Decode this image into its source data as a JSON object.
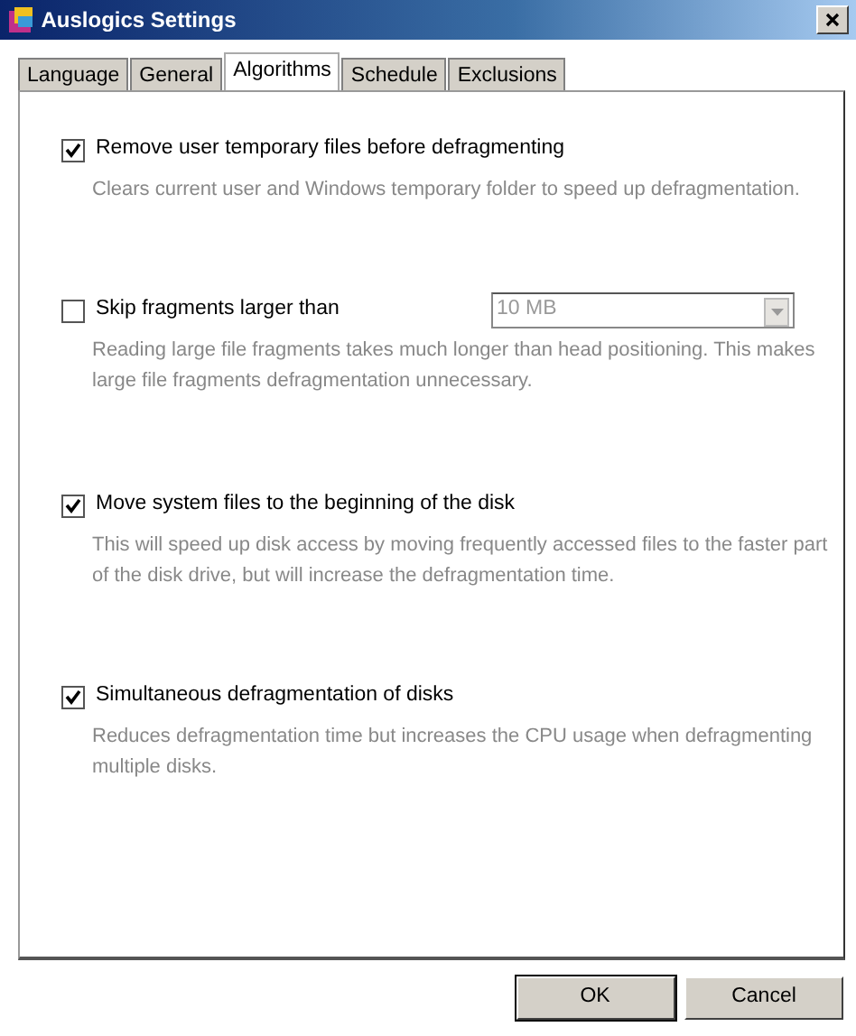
{
  "window": {
    "title": "Auslogics Settings"
  },
  "tabs": [
    {
      "label": "Language",
      "selected": false
    },
    {
      "label": "General",
      "selected": false
    },
    {
      "label": "Algorithms",
      "selected": true
    },
    {
      "label": "Schedule",
      "selected": false
    },
    {
      "label": "Exclusions",
      "selected": false
    }
  ],
  "options": [
    {
      "label": "Remove user temporary files before defragmenting",
      "checked": true,
      "description": "Clears current user and Windows temporary folder to speed up defragmentation."
    },
    {
      "label": "Skip fragments larger than",
      "checked": false,
      "description": "Reading large file fragments takes much longer than head positioning. This makes large file fragments defragmentation unnecessary.",
      "dropdown": {
        "value": "10 MB",
        "disabled": true
      }
    },
    {
      "label": "Move system files to the beginning of the disk",
      "checked": true,
      "description": "This will speed up disk access by moving frequently accessed files to the faster part of the disk drive, but will increase the defragmentation time."
    },
    {
      "label": "Simultaneous defragmentation of disks",
      "checked": true,
      "description": "Reduces defragmentation time but increases the CPU usage when defragmenting multiple disks."
    }
  ],
  "buttons": [
    {
      "label": "OK",
      "focused": true
    },
    {
      "label": "Cancel",
      "focused": false
    }
  ]
}
